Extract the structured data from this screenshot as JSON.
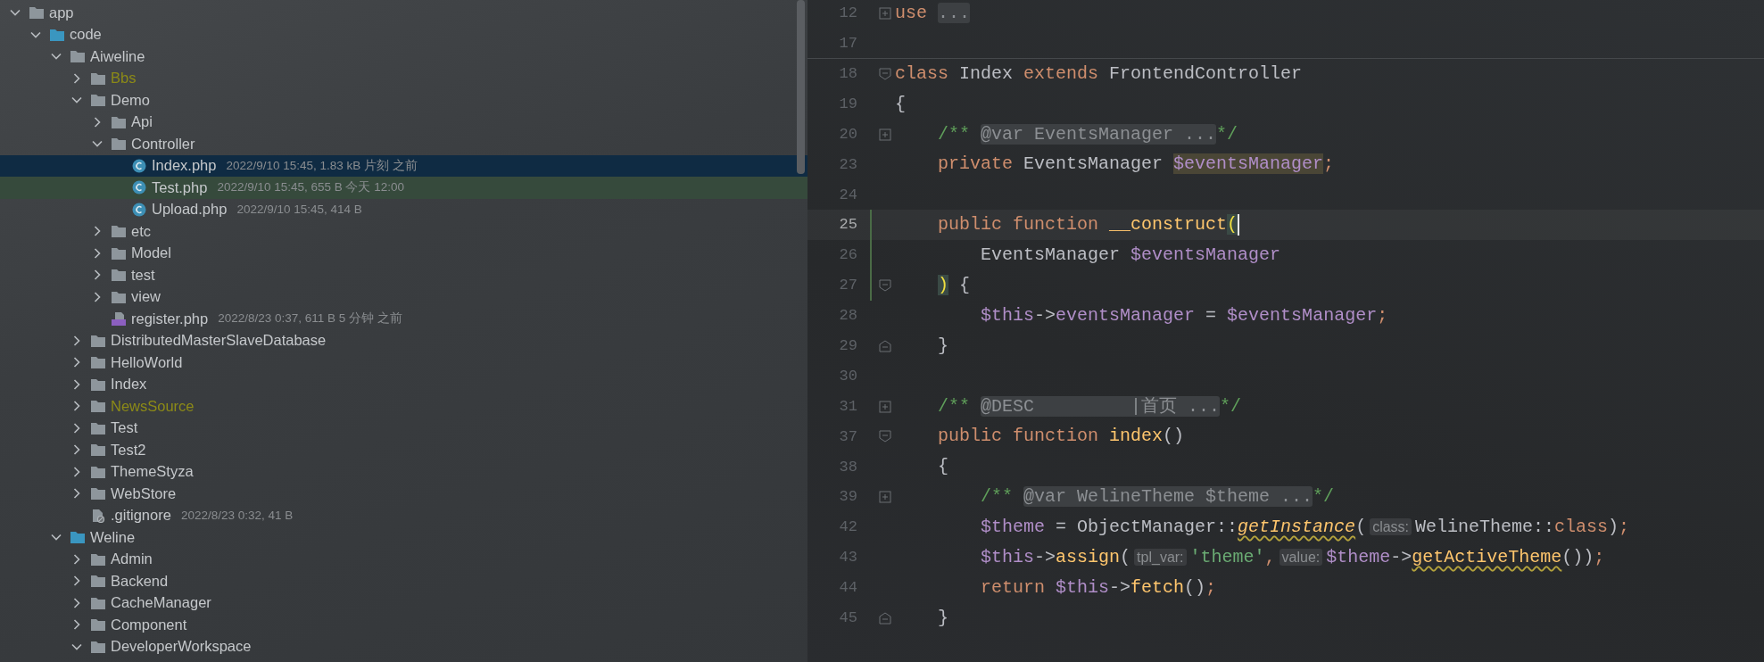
{
  "project_tree": [
    {
      "name": "app",
      "kind": "folder",
      "expanded": true,
      "selected": false,
      "hovered": false,
      "ignored": false,
      "children": [
        {
          "name": "code",
          "kind": "source-folder",
          "expanded": true,
          "selected": false,
          "hovered": false,
          "ignored": false,
          "children": [
            {
              "name": "Aiweline",
              "kind": "folder",
              "expanded": true,
              "selected": false,
              "hovered": false,
              "ignored": false,
              "children": [
                {
                  "name": "Bbs",
                  "kind": "folder",
                  "expanded": false,
                  "selected": false,
                  "hovered": false,
                  "ignored": true
                },
                {
                  "name": "Demo",
                  "kind": "folder",
                  "expanded": true,
                  "selected": false,
                  "hovered": false,
                  "ignored": false,
                  "children": [
                    {
                      "name": "Api",
                      "kind": "folder",
                      "expanded": false,
                      "selected": false,
                      "hovered": false,
                      "ignored": false
                    },
                    {
                      "name": "Controller",
                      "kind": "folder",
                      "expanded": true,
                      "selected": false,
                      "hovered": false,
                      "ignored": false,
                      "children": [
                        {
                          "name": "Index.php",
                          "kind": "class-file",
                          "meta": "2022/9/10 15:45, 1.83 kB 片刻 之前",
                          "selected": true,
                          "hovered": false,
                          "ignored": false
                        },
                        {
                          "name": "Test.php",
                          "kind": "class-file",
                          "meta": "2022/9/10 15:45, 655 B 今天 12:00",
                          "selected": false,
                          "hovered": true,
                          "ignored": false
                        },
                        {
                          "name": "Upload.php",
                          "kind": "class-file",
                          "meta": "2022/9/10 15:45, 414 B",
                          "selected": false,
                          "hovered": false,
                          "ignored": false
                        }
                      ]
                    },
                    {
                      "name": "etc",
                      "kind": "folder",
                      "expanded": false,
                      "selected": false,
                      "hovered": false,
                      "ignored": false
                    },
                    {
                      "name": "Model",
                      "kind": "folder",
                      "expanded": false,
                      "selected": false,
                      "hovered": false,
                      "ignored": false
                    },
                    {
                      "name": "test",
                      "kind": "folder",
                      "expanded": false,
                      "selected": false,
                      "hovered": false,
                      "ignored": false
                    },
                    {
                      "name": "view",
                      "kind": "folder",
                      "expanded": false,
                      "selected": false,
                      "hovered": false,
                      "ignored": false
                    },
                    {
                      "name": "register.php",
                      "kind": "php-file",
                      "meta": "2022/8/23 0:37, 611 B 5 分钟 之前",
                      "selected": false,
                      "hovered": false,
                      "ignored": false
                    }
                  ]
                },
                {
                  "name": "DistributedMasterSlaveDatabase",
                  "kind": "folder",
                  "expanded": false,
                  "selected": false,
                  "hovered": false,
                  "ignored": false
                },
                {
                  "name": "HelloWorld",
                  "kind": "folder",
                  "expanded": false,
                  "selected": false,
                  "hovered": false,
                  "ignored": false
                },
                {
                  "name": "Index",
                  "kind": "folder",
                  "expanded": false,
                  "selected": false,
                  "hovered": false,
                  "ignored": false
                },
                {
                  "name": "NewsSource",
                  "kind": "folder",
                  "expanded": false,
                  "selected": false,
                  "hovered": false,
                  "ignored": true
                },
                {
                  "name": "Test",
                  "kind": "folder",
                  "expanded": false,
                  "selected": false,
                  "hovered": false,
                  "ignored": false
                },
                {
                  "name": "Test2",
                  "kind": "folder",
                  "expanded": false,
                  "selected": false,
                  "hovered": false,
                  "ignored": false
                },
                {
                  "name": "ThemeStyza",
                  "kind": "folder",
                  "expanded": false,
                  "selected": false,
                  "hovered": false,
                  "ignored": false
                },
                {
                  "name": "WebStore",
                  "kind": "folder",
                  "expanded": false,
                  "selected": false,
                  "hovered": false,
                  "ignored": false
                },
                {
                  "name": ".gitignore",
                  "kind": "ignore-file",
                  "meta": "2022/8/23 0:32, 41 B",
                  "selected": false,
                  "hovered": false,
                  "ignored": false
                }
              ]
            },
            {
              "name": "Weline",
              "kind": "source-folder",
              "expanded": true,
              "selected": false,
              "hovered": false,
              "ignored": false,
              "children": [
                {
                  "name": "Admin",
                  "kind": "folder",
                  "expanded": false,
                  "selected": false,
                  "hovered": false,
                  "ignored": false
                },
                {
                  "name": "Backend",
                  "kind": "folder",
                  "expanded": false,
                  "selected": false,
                  "hovered": false,
                  "ignored": false
                },
                {
                  "name": "CacheManager",
                  "kind": "folder",
                  "expanded": false,
                  "selected": false,
                  "hovered": false,
                  "ignored": false
                },
                {
                  "name": "Component",
                  "kind": "folder",
                  "expanded": false,
                  "selected": false,
                  "hovered": false,
                  "ignored": false
                },
                {
                  "name": "DeveloperWorkspace",
                  "kind": "folder",
                  "expanded": true,
                  "selected": false,
                  "hovered": false,
                  "ignored": false
                }
              ]
            }
          ]
        }
      ]
    }
  ],
  "editor": {
    "lines": [
      {
        "n": "12",
        "fold": {
          "kind": "collapsed"
        },
        "tokens": [
          {
            "kind": "kw",
            "t": "use "
          },
          {
            "kind": "folded",
            "t": "..."
          }
        ]
      },
      {
        "n": "17",
        "separator": true
      },
      {
        "n": "18",
        "fold": {
          "kind": "start"
        },
        "tokens": [
          {
            "kind": "kw",
            "t": "class "
          },
          {
            "kind": "plain",
            "t": "Index "
          },
          {
            "kind": "kw",
            "t": "extends "
          },
          {
            "kind": "plain",
            "t": "FrontendController"
          }
        ]
      },
      {
        "n": "19",
        "tokens": [
          {
            "kind": "plain",
            "t": "{"
          }
        ]
      },
      {
        "n": "20",
        "fold": {
          "kind": "collapsed"
        },
        "tokens": [
          {
            "kind": "comment",
            "t": "    /** "
          },
          {
            "kind": "folded",
            "t": "@var EventsManager ..."
          },
          {
            "kind": "comment",
            "t": "*/"
          }
        ]
      },
      {
        "n": "23",
        "tokens": [
          {
            "kind": "kw",
            "t": "    private"
          },
          {
            "kind": "plain",
            "t": " EventsManager "
          },
          {
            "kind": "var-hl",
            "t": "$eventsManager"
          },
          {
            "kind": "kw",
            "t": ";"
          }
        ]
      },
      {
        "n": "24"
      },
      {
        "n": "25",
        "current": true,
        "changed": true,
        "caret": true,
        "tokens": [
          {
            "kind": "kw",
            "t": "    public function "
          },
          {
            "kind": "func",
            "t": "__construct"
          },
          {
            "kind": "brace",
            "t": "("
          }
        ]
      },
      {
        "n": "26",
        "changed": true,
        "tokens": [
          {
            "kind": "plain",
            "t": "        EventsManager "
          },
          {
            "kind": "var",
            "t": "$eventsManager"
          }
        ]
      },
      {
        "n": "27",
        "changed": true,
        "fold": {
          "kind": "start"
        },
        "tokens": [
          {
            "kind": "brace",
            "t": "    )"
          },
          {
            "kind": "plain",
            "t": " {"
          }
        ]
      },
      {
        "n": "28",
        "tokens": [
          {
            "kind": "var",
            "t": "        $this"
          },
          {
            "kind": "plain",
            "t": "->"
          },
          {
            "kind": "var",
            "t": "eventsManager"
          },
          {
            "kind": "plain",
            "t": " = "
          },
          {
            "kind": "var",
            "t": "$eventsManager"
          },
          {
            "kind": "kw",
            "t": ";"
          }
        ]
      },
      {
        "n": "29",
        "fold": {
          "kind": "end"
        },
        "tokens": [
          {
            "kind": "plain",
            "t": "    }"
          }
        ]
      },
      {
        "n": "30"
      },
      {
        "n": "31",
        "fold": {
          "kind": "collapsed"
        },
        "tokens": [
          {
            "kind": "comment",
            "t": "    /** "
          },
          {
            "kind": "folded",
            "t": "@DESC         |首页 ..."
          },
          {
            "kind": "comment",
            "t": "*/"
          }
        ]
      },
      {
        "n": "37",
        "fold": {
          "kind": "start"
        },
        "tokens": [
          {
            "kind": "kw",
            "t": "    public function "
          },
          {
            "kind": "func",
            "t": "index"
          },
          {
            "kind": "plain",
            "t": "()"
          }
        ]
      },
      {
        "n": "38",
        "tokens": [
          {
            "kind": "plain",
            "t": "    {"
          }
        ]
      },
      {
        "n": "39",
        "fold": {
          "kind": "collapsed"
        },
        "tokens": [
          {
            "kind": "comment",
            "t": "        /** "
          },
          {
            "kind": "folded",
            "t": "@var WelineTheme $theme ..."
          },
          {
            "kind": "comment",
            "t": "*/"
          }
        ]
      },
      {
        "n": "42",
        "tokens": [
          {
            "kind": "var",
            "t": "        $theme"
          },
          {
            "kind": "plain",
            "t": " = ObjectManager::"
          },
          {
            "kind": "static-warn",
            "t": "getInstance"
          },
          {
            "kind": "plain",
            "t": "("
          },
          {
            "kind": "hint",
            "t": "class:"
          },
          {
            "kind": "plain",
            "t": "WelineTheme::"
          },
          {
            "kind": "kw",
            "t": "class"
          },
          {
            "kind": "plain",
            "t": ")"
          },
          {
            "kind": "kw",
            "t": ";"
          }
        ]
      },
      {
        "n": "43",
        "tokens": [
          {
            "kind": "var",
            "t": "        $this"
          },
          {
            "kind": "plain",
            "t": "->"
          },
          {
            "kind": "func",
            "t": "assign"
          },
          {
            "kind": "plain",
            "t": "("
          },
          {
            "kind": "hint",
            "t": "tpl_var:"
          },
          {
            "kind": "string",
            "t": "'theme'"
          },
          {
            "kind": "kw",
            "t": ","
          },
          {
            "kind": "hint",
            "t": "value:"
          },
          {
            "kind": "var",
            "t": "$theme"
          },
          {
            "kind": "plain",
            "t": "->"
          },
          {
            "kind": "call-warn",
            "t": "getActiveTheme"
          },
          {
            "kind": "plain",
            "t": "())"
          },
          {
            "kind": "kw",
            "t": ";"
          }
        ]
      },
      {
        "n": "44",
        "tokens": [
          {
            "kind": "kw",
            "t": "        return "
          },
          {
            "kind": "var",
            "t": "$this"
          },
          {
            "kind": "plain",
            "t": "->"
          },
          {
            "kind": "func",
            "t": "fetch"
          },
          {
            "kind": "plain",
            "t": "()"
          },
          {
            "kind": "kw",
            "t": ";"
          }
        ]
      },
      {
        "n": "45",
        "fold": {
          "kind": "end"
        },
        "tokens": [
          {
            "kind": "plain",
            "t": "    }"
          }
        ]
      }
    ]
  }
}
